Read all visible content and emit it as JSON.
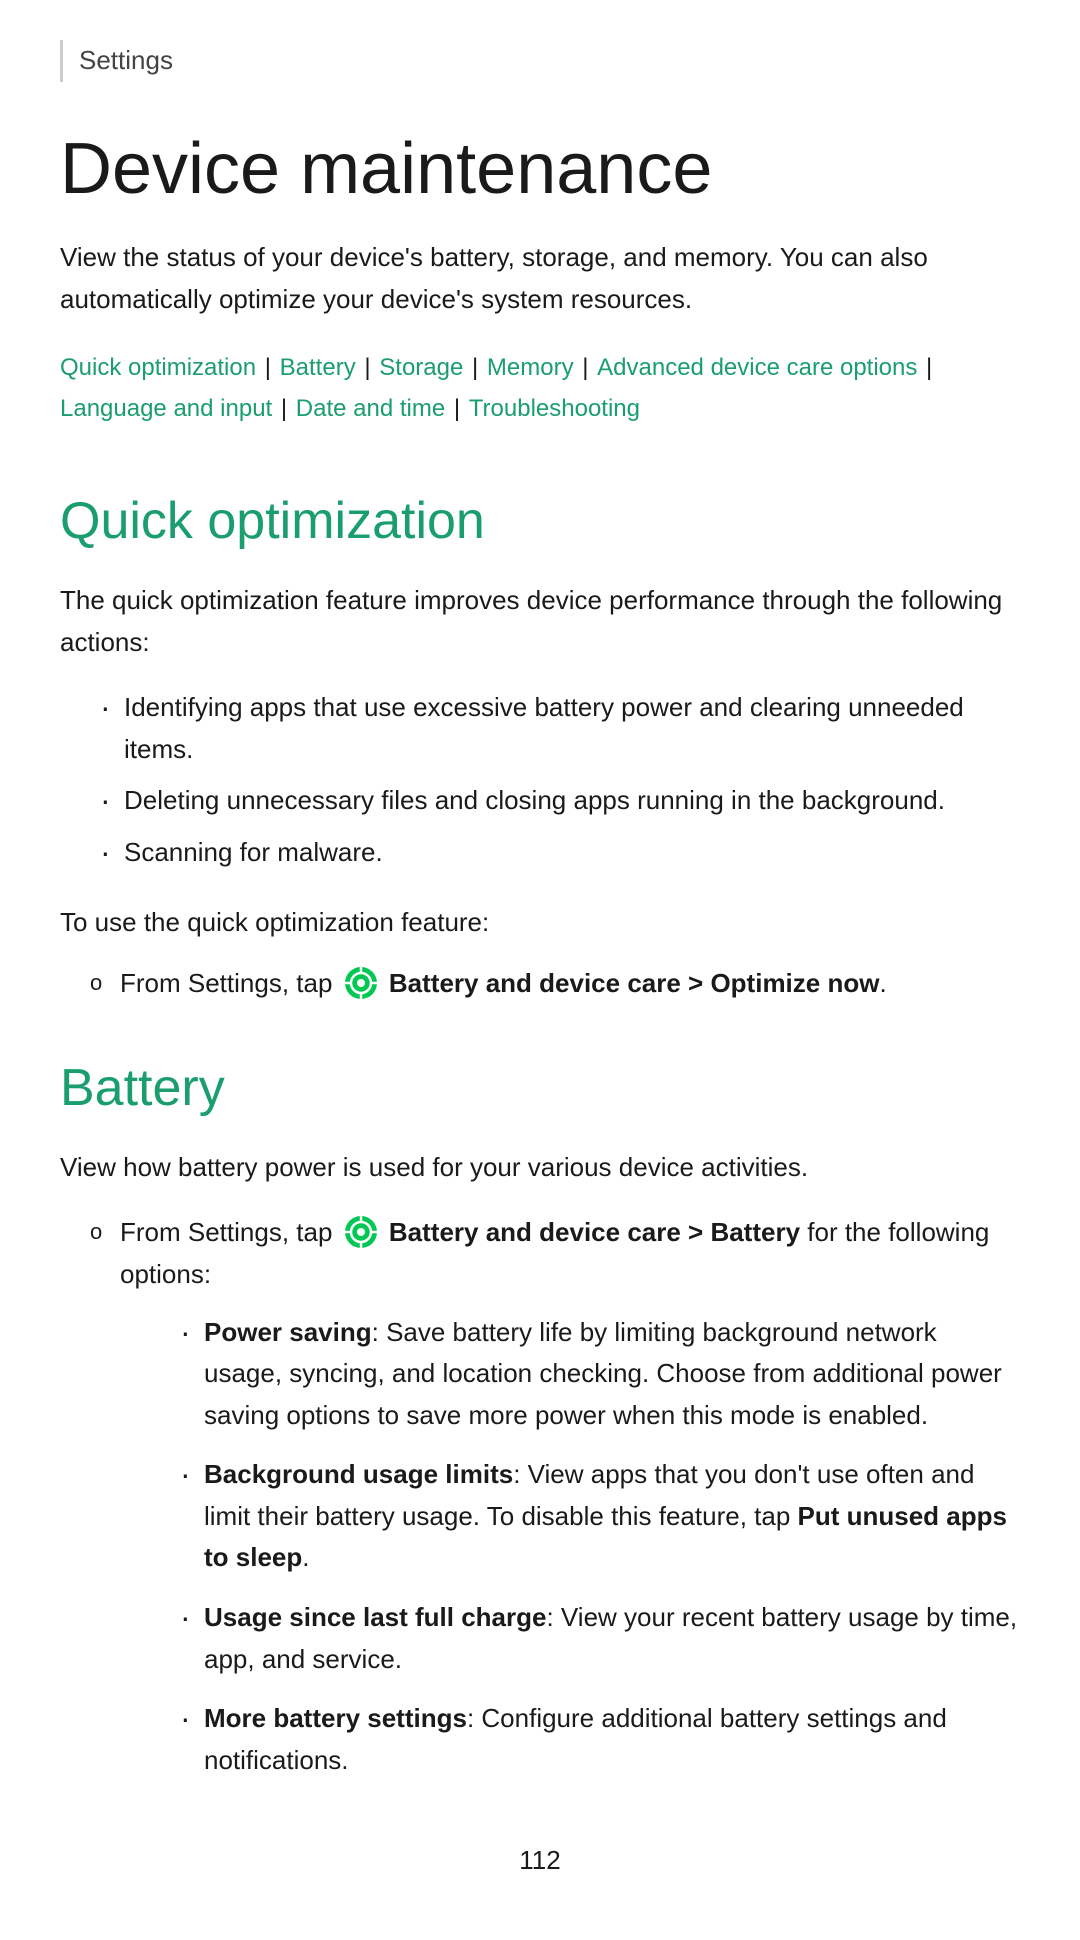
{
  "breadcrumb": {
    "label": "Settings"
  },
  "page": {
    "title": "Device maintenance",
    "intro": "View the status of your device's battery, storage, and memory. You can also automatically optimize your device's system resources.",
    "page_number": "112"
  },
  "nav": {
    "links": [
      {
        "label": "Quick optimization"
      },
      {
        "label": "Battery"
      },
      {
        "label": "Storage"
      },
      {
        "label": "Memory"
      },
      {
        "label": "Advanced device care options"
      },
      {
        "label": "Language and input"
      },
      {
        "label": "Date and time"
      },
      {
        "label": "Troubleshooting"
      }
    ]
  },
  "sections": {
    "quick_optimization": {
      "title": "Quick optimization",
      "desc": "The quick optimization feature improves device performance through the following actions:",
      "bullets": [
        "Identifying apps that use excessive battery power and clearing unneeded items.",
        "Deleting unnecessary files and closing apps running in the background.",
        "Scanning for malware."
      ],
      "step_intro": "To use the quick optimization feature:",
      "step": "From Settings, tap",
      "step_bold": "Battery and device care > Optimize now",
      "step_end": "."
    },
    "battery": {
      "title": "Battery",
      "desc": "View how battery power is used for your various device activities.",
      "step": "From Settings, tap",
      "step_bold": "Battery and device care > Battery",
      "step_end": " for the following options:",
      "sub_bullets": [
        {
          "bold": "Power saving",
          "text": ": Save battery life by limiting background network usage, syncing, and location checking. Choose from additional power saving options to save more power when this mode is enabled."
        },
        {
          "bold": "Background usage limits",
          "text": ": View apps that you don’t use often and limit their battery usage. To disable this feature, tap",
          "bold2": " Put unused apps to sleep",
          "text2": "."
        },
        {
          "bold": "Usage since last full charge",
          "text": ": View your recent battery usage by time, app, and service."
        },
        {
          "bold": "More battery settings",
          "text": ": Configure additional battery settings and notifications."
        }
      ]
    }
  }
}
